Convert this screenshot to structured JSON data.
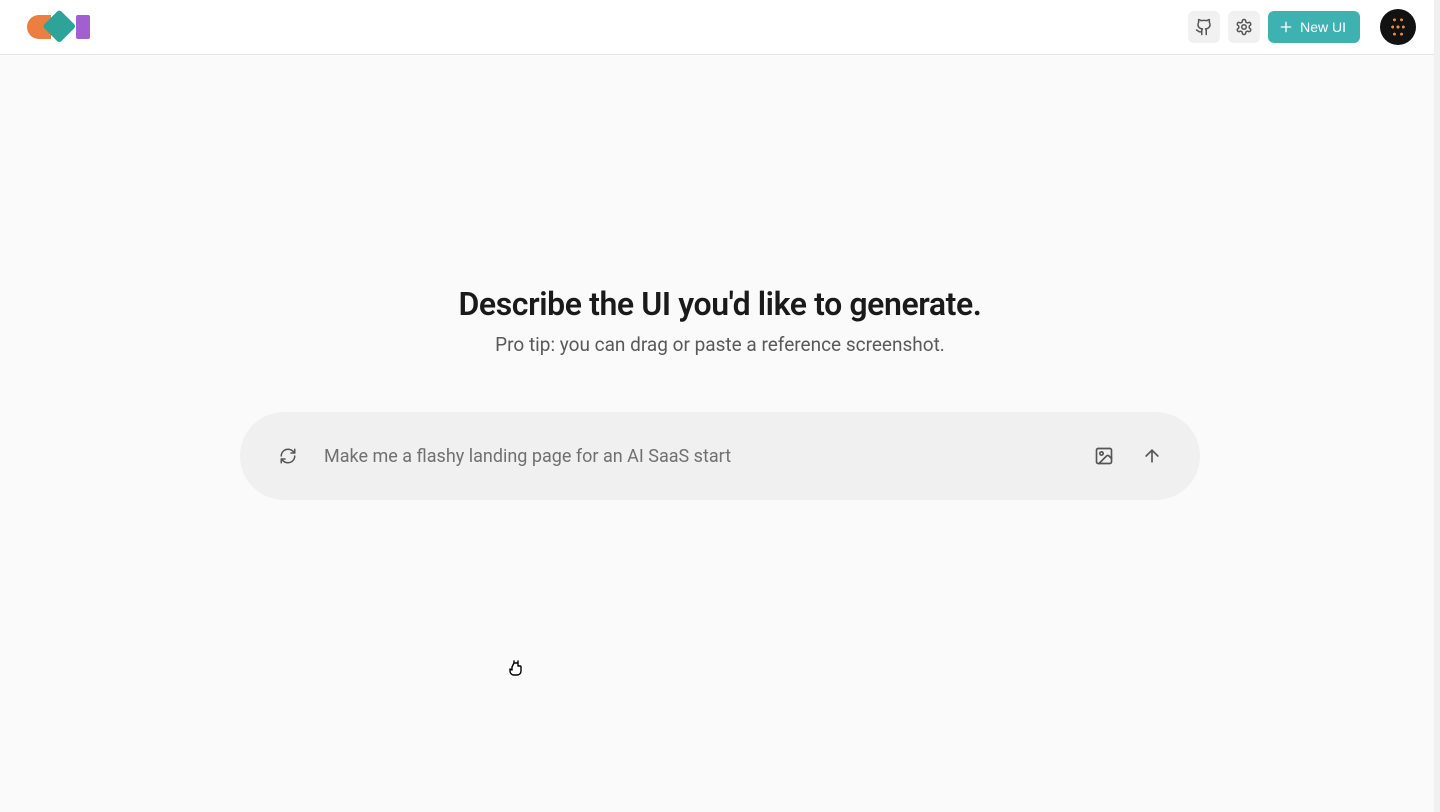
{
  "header": {
    "new_ui_label": "New UI"
  },
  "main": {
    "heading": "Describe the UI you'd like to generate.",
    "subheading": "Pro tip: you can drag or paste a reference screenshot."
  },
  "prompt": {
    "placeholder": "Make me a flashy landing page for an AI SaaS start",
    "value": ""
  }
}
